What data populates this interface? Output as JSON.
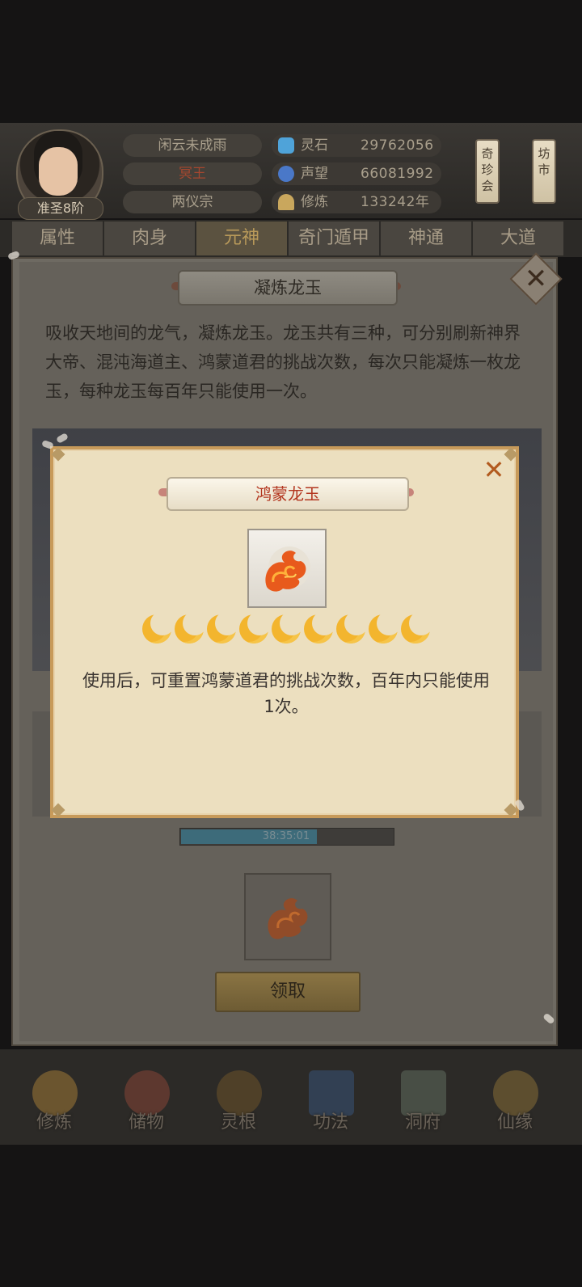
{
  "player": {
    "rank": "准圣8阶",
    "name": "闲云未成雨",
    "title": "冥王",
    "sect": "两仪宗"
  },
  "resources": [
    {
      "label": "灵石",
      "value": "29762056",
      "icon": "spirit-stone-icon",
      "color": "#4fa3d9"
    },
    {
      "label": "声望",
      "value": "66081992",
      "icon": "prestige-icon",
      "color": "#4a78c8"
    },
    {
      "label": "修炼",
      "value": "133242年",
      "icon": "cultivate-icon",
      "color": "#c9a75d"
    }
  ],
  "side_buttons": {
    "treasure": "奇珍会",
    "market": "坊市"
  },
  "tabs": [
    {
      "label": "属性"
    },
    {
      "label": "肉身"
    },
    {
      "label": "元神"
    },
    {
      "label": "奇门遁甲"
    },
    {
      "label": "神通"
    },
    {
      "label": "大道"
    }
  ],
  "active_tab": "元神",
  "panel": {
    "title": "凝炼龙玉",
    "description": "吸收天地间的龙气，凝炼龙玉。龙玉共有三种，可分别刷新神界大帝、混沌海道主、鸿蒙道君的挑战次数，每次只能凝炼一枚龙玉，每种龙玉每百年只能使用一次。",
    "timer": "38:35:01",
    "progress": 0.64,
    "claim_label": "领取"
  },
  "dialog": {
    "title": "鸿蒙龙玉",
    "moon_count": 9,
    "description": "使用后，可重置鸿蒙道君的挑战次数，百年内只能使用1次。",
    "close_icon": "close-icon"
  },
  "bottom_nav": [
    {
      "label": "修炼",
      "icon": "cultivate-nav-icon",
      "color": "#b98a3a"
    },
    {
      "label": "储物",
      "icon": "storage-bag-icon",
      "color": "#9a4a3a"
    },
    {
      "label": "灵根",
      "icon": "spirit-root-icon",
      "color": "#7a5a2a"
    },
    {
      "label": "功法",
      "icon": "technique-book-icon",
      "color": "#3a5a8a"
    },
    {
      "label": "洞府",
      "icon": "cave-dwelling-icon",
      "color": "#6a7a6a"
    },
    {
      "label": "仙缘",
      "icon": "immortal-fate-icon",
      "color": "#9a7a3a"
    }
  ]
}
